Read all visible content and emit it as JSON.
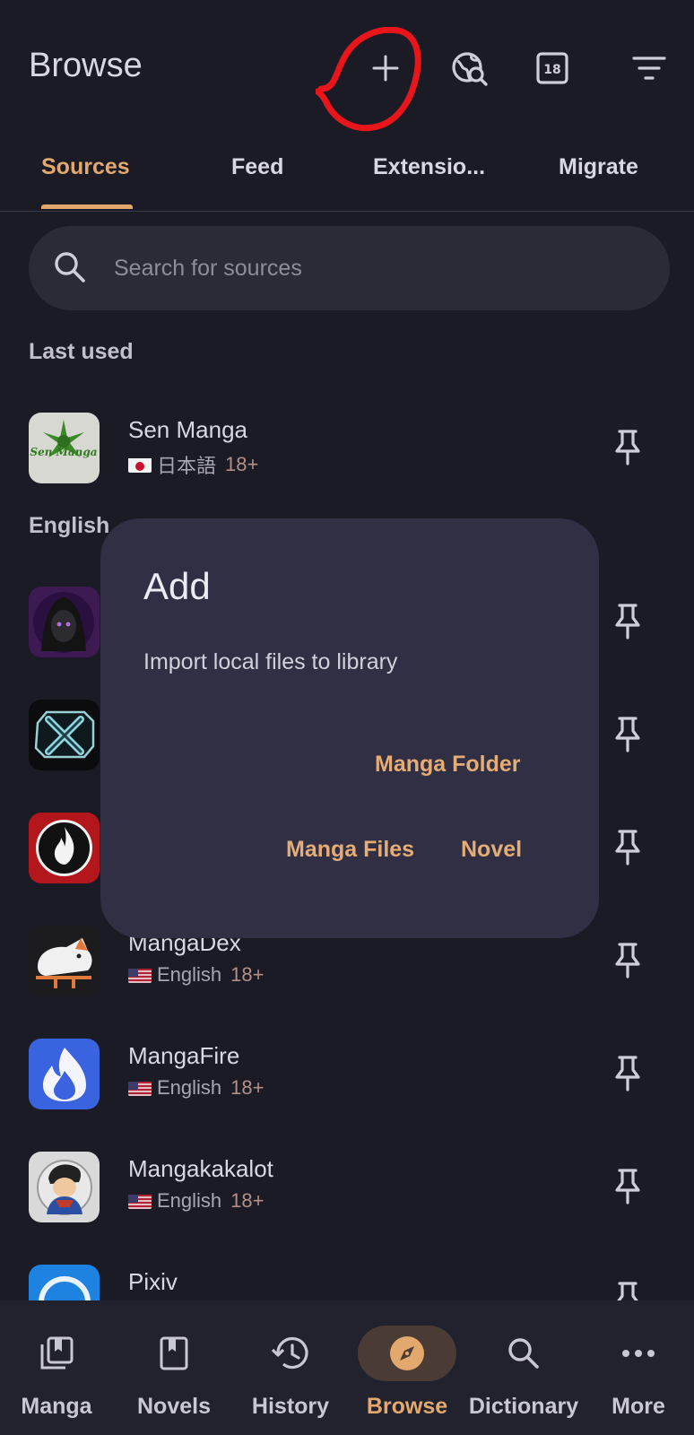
{
  "header": {
    "title": "Browse",
    "icons": [
      "plus-icon",
      "global-search-icon",
      "adult-filter-icon",
      "filter-icon"
    ],
    "adult_badge": "18",
    "annotation_color": "#e8151b"
  },
  "tabs": [
    {
      "label": "Sources",
      "active": true
    },
    {
      "label": "Feed",
      "active": false
    },
    {
      "label": "Extensio...",
      "active": false
    },
    {
      "label": "Migrate",
      "active": false
    }
  ],
  "search": {
    "placeholder": "Search for sources",
    "value": ""
  },
  "sections": {
    "last_used": "Last used",
    "english": "English"
  },
  "last_used": [
    {
      "name": "Sen Manga",
      "language": "日本語",
      "nsfw": "18+",
      "logo_text": "Sen Manga"
    }
  ],
  "english_sources": [
    {
      "name": "",
      "language": "",
      "nsfw": ""
    },
    {
      "name": "",
      "language": "",
      "nsfw": ""
    },
    {
      "name": "",
      "language": "",
      "nsfw": ""
    },
    {
      "name": "MangaDex",
      "language": "English",
      "nsfw": "18+"
    },
    {
      "name": "MangaFire",
      "language": "English",
      "nsfw": "18+"
    },
    {
      "name": "Mangakakalot",
      "language": "English",
      "nsfw": "18+"
    },
    {
      "name": "Pixiv",
      "language": "",
      "nsfw": ""
    }
  ],
  "dialog": {
    "title": "Add",
    "body": "Import local files to library",
    "buttons": {
      "folder": "Manga Folder",
      "files": "Manga Files",
      "novel": "Novel"
    }
  },
  "bottom_nav": [
    {
      "label": "Manga",
      "icon": "library-icon",
      "active": false
    },
    {
      "label": "Novels",
      "icon": "book-icon",
      "active": false
    },
    {
      "label": "History",
      "icon": "history-icon",
      "active": false
    },
    {
      "label": "Browse",
      "icon": "compass-icon",
      "active": true
    },
    {
      "label": "Dictionary",
      "icon": "search-icon",
      "active": false
    },
    {
      "label": "More",
      "icon": "more-icon",
      "active": false
    }
  ],
  "colors": {
    "accent": "#e2a86d",
    "background": "#1a1b24",
    "dialog": "#302f44"
  }
}
